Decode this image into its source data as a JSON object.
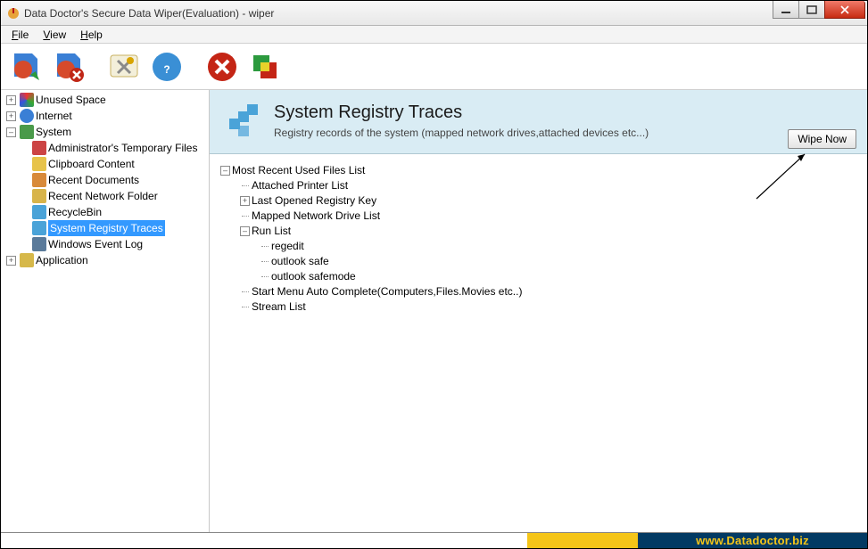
{
  "title": "Data Doctor's Secure Data Wiper(Evaluation) - wiper",
  "menu": {
    "file": "File",
    "view": "View",
    "help": "Help"
  },
  "sidebar": {
    "items": [
      {
        "label": "Unused Space",
        "expand": "+"
      },
      {
        "label": "Internet",
        "expand": "+"
      },
      {
        "label": "System",
        "expand": "–",
        "children": [
          {
            "label": "Administrator's Temporary Files"
          },
          {
            "label": "Clipboard Content"
          },
          {
            "label": "Recent Documents"
          },
          {
            "label": "Recent Network Folder"
          },
          {
            "label": "RecycleBin"
          },
          {
            "label": "System Registry Traces",
            "selected": true
          },
          {
            "label": "Windows Event Log"
          }
        ]
      },
      {
        "label": "Application",
        "expand": "+"
      }
    ]
  },
  "banner": {
    "title": "System Registry Traces",
    "subtitle": "Registry records of the system (mapped network drives,attached devices etc...)",
    "button": "Wipe Now"
  },
  "details": [
    {
      "label": "Most Recent Used Files List",
      "expand": "–",
      "children": [
        {
          "label": "Attached Printer List"
        },
        {
          "label": "Last Opened Registry Key",
          "expand": "+"
        },
        {
          "label": "Mapped Network Drive List"
        },
        {
          "label": "Run List",
          "expand": "–",
          "children": [
            {
              "label": "regedit"
            },
            {
              "label": "outlook safe"
            },
            {
              "label": "outlook safemode"
            }
          ]
        },
        {
          "label": "Start Menu Auto Complete(Computers,Files.Movies etc..)"
        },
        {
          "label": "Stream List"
        }
      ]
    }
  ],
  "footer": {
    "url": "www.Datadoctor.biz"
  },
  "colors": {
    "accent": "#3399ff",
    "banner": "#d9ecf4"
  }
}
